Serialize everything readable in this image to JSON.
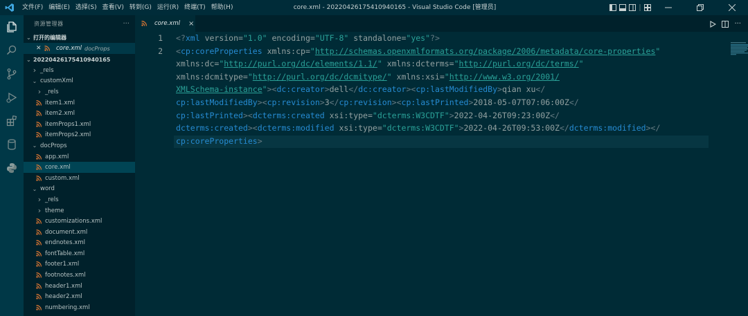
{
  "menu": [
    "文件(F)",
    "编辑(E)",
    "选择(S)",
    "查看(V)",
    "转到(G)",
    "运行(R)",
    "终端(T)",
    "帮助(H)"
  ],
  "window_title": "core.xml - 20220426175410940165 - Visual Studio Code [管理员]",
  "sidebar": {
    "title": "资源管理器",
    "more": "···",
    "open_editors_label": "打开的编辑器",
    "open_editor": {
      "name": "core.xml",
      "dir": "docProps"
    },
    "root_label": "20220426175410940165",
    "tree": [
      {
        "label": "_rels",
        "type": "folder",
        "depth": 1,
        "expanded": false
      },
      {
        "label": "customXml",
        "type": "folder",
        "depth": 1,
        "expanded": true
      },
      {
        "label": "_rels",
        "type": "folder",
        "depth": 2,
        "expanded": false
      },
      {
        "label": "item1.xml",
        "type": "file",
        "depth": 2
      },
      {
        "label": "item2.xml",
        "type": "file",
        "depth": 2
      },
      {
        "label": "itemProps1.xml",
        "type": "file",
        "depth": 2
      },
      {
        "label": "itemProps2.xml",
        "type": "file",
        "depth": 2
      },
      {
        "label": "docProps",
        "type": "folder",
        "depth": 1,
        "expanded": true
      },
      {
        "label": "app.xml",
        "type": "file",
        "depth": 2
      },
      {
        "label": "core.xml",
        "type": "file",
        "depth": 2,
        "active": true
      },
      {
        "label": "custom.xml",
        "type": "file",
        "depth": 2
      },
      {
        "label": "word",
        "type": "folder",
        "depth": 1,
        "expanded": true
      },
      {
        "label": "_rels",
        "type": "folder",
        "depth": 2,
        "expanded": false
      },
      {
        "label": "theme",
        "type": "folder",
        "depth": 2,
        "expanded": false
      },
      {
        "label": "customizations.xml",
        "type": "file",
        "depth": 2
      },
      {
        "label": "document.xml",
        "type": "file",
        "depth": 2
      },
      {
        "label": "endnotes.xml",
        "type": "file",
        "depth": 2
      },
      {
        "label": "fontTable.xml",
        "type": "file",
        "depth": 2
      },
      {
        "label": "footer1.xml",
        "type": "file",
        "depth": 2
      },
      {
        "label": "footnotes.xml",
        "type": "file",
        "depth": 2
      },
      {
        "label": "header1.xml",
        "type": "file",
        "depth": 2
      },
      {
        "label": "header2.xml",
        "type": "file",
        "depth": 2
      },
      {
        "label": "numbering.xml",
        "type": "file",
        "depth": 2
      }
    ]
  },
  "tab": {
    "name": "core.xml",
    "close": "×"
  },
  "editor": {
    "line_numbers": [
      "1",
      "2"
    ],
    "lines": [
      [
        [
          "pu",
          "<?"
        ],
        [
          "tg",
          "xml"
        ],
        [
          "at",
          " version="
        ],
        [
          "st",
          "\"1.0\""
        ],
        [
          "at",
          " encoding="
        ],
        [
          "st",
          "\"UTF-8\""
        ],
        [
          "at",
          " standalone="
        ],
        [
          "st",
          "\"yes\""
        ],
        [
          "pu",
          "?>"
        ]
      ],
      [
        [
          "pu",
          "<"
        ],
        [
          "tg",
          "cp:coreProperties"
        ],
        [
          "at",
          " xmlns:cp="
        ],
        [
          "st",
          "\""
        ],
        [
          "ur",
          "http://schemas.openxmlformats.org/package/2006/metadata/core-properties"
        ],
        [
          "st",
          "\""
        ]
      ],
      [
        [
          "at",
          "xmlns:dc="
        ],
        [
          "st",
          "\""
        ],
        [
          "ur",
          "http://purl.org/dc/elements/1.1/"
        ],
        [
          "st",
          "\""
        ],
        [
          "at",
          " xmlns:dcterms="
        ],
        [
          "st",
          "\""
        ],
        [
          "ur",
          "http://purl.org/dc/terms/"
        ],
        [
          "st",
          "\""
        ]
      ],
      [
        [
          "at",
          "xmlns:dcmitype="
        ],
        [
          "st",
          "\""
        ],
        [
          "ur",
          "http://purl.org/dc/dcmitype/"
        ],
        [
          "st",
          "\""
        ],
        [
          "at",
          " xmlns:xsi="
        ],
        [
          "st",
          "\""
        ],
        [
          "ur",
          "http://www.w3.org/2001/"
        ]
      ],
      [
        [
          "ur",
          "XMLSchema-instance"
        ],
        [
          "st",
          "\""
        ],
        [
          "pu",
          ">"
        ],
        [
          "pu",
          "<"
        ],
        [
          "tg",
          "dc:creator"
        ],
        [
          "pu",
          ">"
        ],
        [
          "tx",
          "dell"
        ],
        [
          "pu",
          "</"
        ],
        [
          "tg",
          "dc:creator"
        ],
        [
          "pu",
          ">"
        ],
        [
          "pu",
          "<"
        ],
        [
          "tg",
          "cp:lastModifiedBy"
        ],
        [
          "pu",
          ">"
        ],
        [
          "tx",
          "qian xu"
        ],
        [
          "pu",
          "</"
        ]
      ],
      [
        [
          "tg",
          "cp:lastModifiedBy"
        ],
        [
          "pu",
          ">"
        ],
        [
          "pu",
          "<"
        ],
        [
          "tg",
          "cp:revision"
        ],
        [
          "pu",
          ">"
        ],
        [
          "tx",
          "3"
        ],
        [
          "pu",
          "</"
        ],
        [
          "tg",
          "cp:revision"
        ],
        [
          "pu",
          ">"
        ],
        [
          "pu",
          "<"
        ],
        [
          "tg",
          "cp:lastPrinted"
        ],
        [
          "pu",
          ">"
        ],
        [
          "tx",
          "2018-05-07T07:06:00Z"
        ],
        [
          "pu",
          "</"
        ]
      ],
      [
        [
          "tg",
          "cp:lastPrinted"
        ],
        [
          "pu",
          ">"
        ],
        [
          "pu",
          "<"
        ],
        [
          "tg",
          "dcterms:created"
        ],
        [
          "at",
          " xsi:type="
        ],
        [
          "st",
          "\"dcterms:W3CDTF\""
        ],
        [
          "pu",
          ">"
        ],
        [
          "tx",
          "2022-04-26T09:23:00Z"
        ],
        [
          "pu",
          "</"
        ]
      ],
      [
        [
          "tg",
          "dcterms:created"
        ],
        [
          "pu",
          ">"
        ],
        [
          "pu",
          "<"
        ],
        [
          "tg",
          "dcterms:modified"
        ],
        [
          "at",
          " xsi:type="
        ],
        [
          "st",
          "\"dcterms:W3CDTF\""
        ],
        [
          "pu",
          ">"
        ],
        [
          "tx",
          "2022-04-26T09:53:00Z"
        ],
        [
          "pu",
          "</"
        ],
        [
          "tg",
          "dcterms:modified"
        ],
        [
          "pu",
          ">"
        ],
        [
          "pu",
          "</"
        ]
      ],
      [
        [
          "tg",
          "cp:coreProperties"
        ],
        [
          "pu",
          ">"
        ]
      ]
    ]
  },
  "colors": {
    "background": "#002b36",
    "sidebar": "#00212b",
    "activity_bar": "#003847",
    "tag": "#268bd2",
    "string": "#2aa198",
    "file_icon": "#e37933"
  },
  "icons": {
    "activity": [
      "explorer-icon",
      "search-icon",
      "source-control-icon",
      "run-debug-icon",
      "extensions-icon",
      "database-icon",
      "python-icon"
    ],
    "title": [
      "vscode-logo-icon",
      "layout-icons",
      "window-controls"
    ]
  }
}
